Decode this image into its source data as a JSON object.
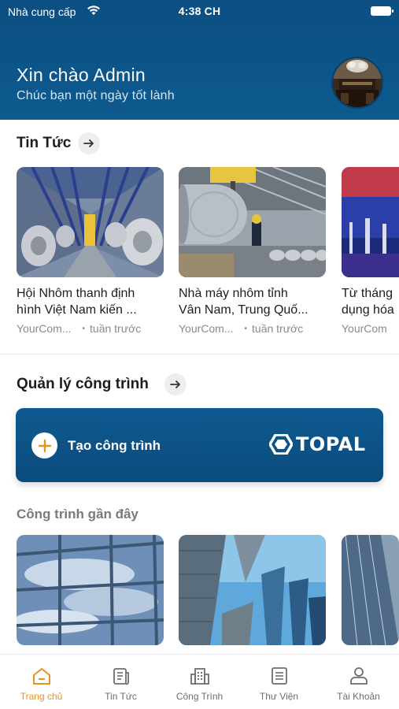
{
  "status_bar": {
    "carrier": "Nhà cung cấp",
    "time": "4:38 CH"
  },
  "header": {
    "greeting": "Xin chào Admin",
    "subtitle": "Chúc bạn một ngày tốt lành"
  },
  "news": {
    "title": "Tin Tức",
    "items": [
      {
        "title_line1": "Hội Nhôm thanh định",
        "title_line2": "hình Việt Nam kiến ...",
        "source": "YourCom...",
        "time": "tuần trước"
      },
      {
        "title_line1": "Nhà máy nhôm tỉnh",
        "title_line2": "Vân Nam, Trung Quố...",
        "source": "YourCom...",
        "time": "tuần trước"
      },
      {
        "title_line1": "Từ tháng",
        "title_line2": "dụng hóa",
        "source": "YourCom",
        "time": ""
      }
    ]
  },
  "projects": {
    "title": "Quản lý công trình",
    "create_label": "Tạo công trình",
    "brand": "TOPAL",
    "recent_title": "Công trình gần đây"
  },
  "tabbar": {
    "items": [
      {
        "label": "Trang chủ",
        "icon": "home-icon",
        "active": true
      },
      {
        "label": "Tin Tức",
        "icon": "news-icon",
        "active": false
      },
      {
        "label": "Công Trình",
        "icon": "building-icon",
        "active": false
      },
      {
        "label": "Thư Viện",
        "icon": "library-icon",
        "active": false
      },
      {
        "label": "Tài Khoản",
        "icon": "user-icon",
        "active": false
      }
    ]
  },
  "colors": {
    "header": "#0c4f82",
    "accent": "#e8921f",
    "card": "#0e5a91"
  }
}
